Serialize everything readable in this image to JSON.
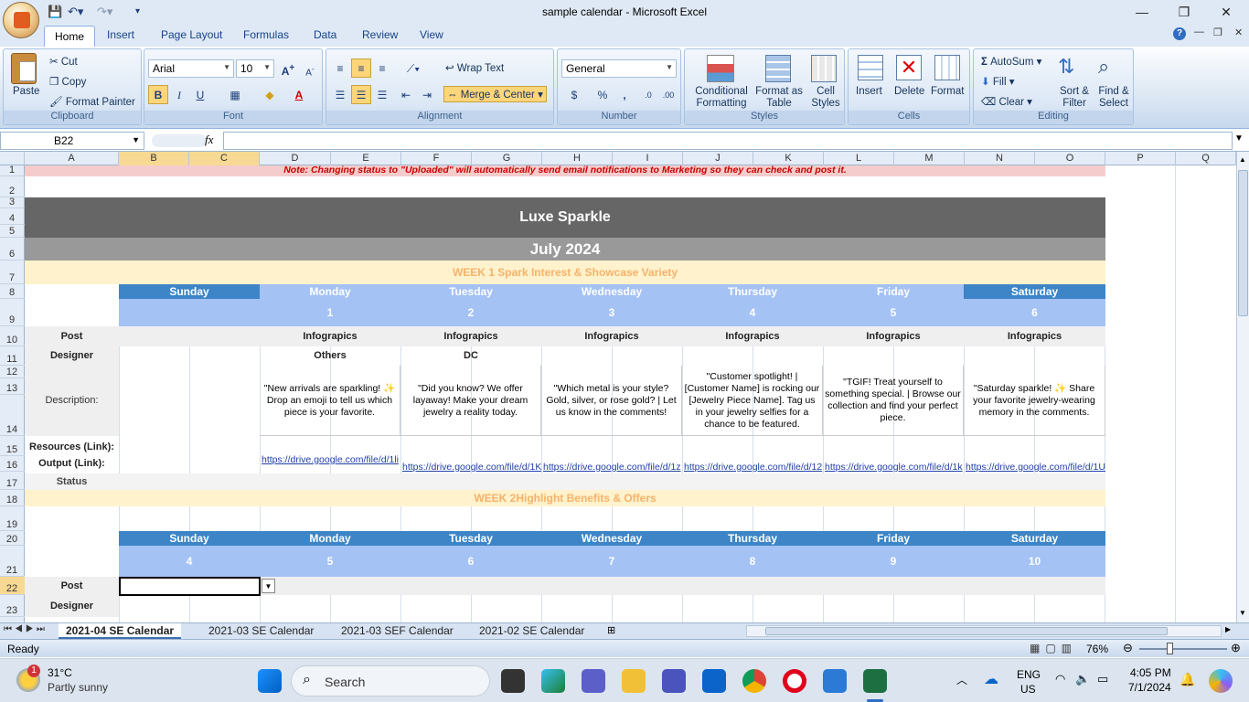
{
  "app": {
    "window_title": "sample calendar - Microsoft Excel",
    "minimize": "—",
    "restore": "❐",
    "close": "✕"
  },
  "ribbon_tabs": [
    "Home",
    "Insert",
    "Page Layout",
    "Formulas",
    "Data",
    "Review",
    "View"
  ],
  "clipboard": {
    "paste": "Paste",
    "cut": "Cut",
    "copy": "Copy",
    "format_painter": "Format Painter",
    "label": "Clipboard"
  },
  "font": {
    "name": "Arial",
    "size": "10",
    "label": "Font",
    "bold": "B",
    "italic": "I",
    "underline": "U"
  },
  "alignment": {
    "wrap_text": "Wrap Text",
    "merge_center": "Merge & Center",
    "label": "Alignment"
  },
  "number": {
    "format": "General",
    "label": "Number",
    "currency": "$",
    "percent": "%",
    "comma": ","
  },
  "styles": {
    "conditional": "Conditional Formatting",
    "format_table": "Format as Table",
    "cell_styles": "Cell Styles",
    "label": "Styles"
  },
  "cells": {
    "insert": "Insert",
    "delete": "Delete",
    "format": "Format",
    "label": "Cells"
  },
  "editing": {
    "autosum": "AutoSum",
    "fill": "Fill",
    "clear": "Clear",
    "sort": "Sort & Filter",
    "find": "Find & Select",
    "label": "Editing"
  },
  "formula_bar": {
    "name_box": "B22",
    "fx": "fx",
    "value": ""
  },
  "columns": [
    "A",
    "B",
    "C",
    "D",
    "E",
    "F",
    "G",
    "H",
    "I",
    "J",
    "K",
    "L",
    "M",
    "N",
    "O",
    "P",
    "Q"
  ],
  "rows": [
    "1",
    "2",
    "3",
    "4",
    "5",
    "6",
    "7",
    "8",
    "9",
    "10",
    "11",
    "12",
    "13",
    "14",
    "15",
    "16",
    "17",
    "18",
    "19",
    "20",
    "21",
    "22",
    "23"
  ],
  "sheet": {
    "note": "Note: Changing status to \"Uploaded\" will automatically send email notifications to Marketing so they can check and post it.",
    "brand": "Luxe Sparkle",
    "month": "July 2024",
    "week1": "WEEK 1 Spark Interest & Showcase Variety",
    "week2": "WEEK 2Highlight Benefits & Offers",
    "days": [
      "Sunday",
      "Monday",
      "Tuesday",
      "Wednesday",
      "Thursday",
      "Friday",
      "Saturday"
    ],
    "week1_dates": [
      "",
      "1",
      "2",
      "3",
      "4",
      "5",
      "6"
    ],
    "week2_dates": [
      "4",
      "5",
      "6",
      "7",
      "8",
      "9",
      "10"
    ],
    "labels": {
      "post": "Post",
      "designer": "Designer",
      "description": "Description:",
      "resources": "Resources (Link):",
      "output": "Output (Link):",
      "status": "Status"
    },
    "posts": [
      "",
      "Infograpics",
      "Infograpics",
      "Infograpics",
      "Infograpics",
      "Infograpics",
      "Infograpics"
    ],
    "designers": [
      "",
      "Others",
      "DC",
      "",
      "",
      "",
      ""
    ],
    "descriptions": [
      "",
      "\"New arrivals are sparkling! ✨ Drop an emoji to tell us which piece is your favorite.",
      "\"Did you know? We offer layaway! Make your dream jewelry a reality today.",
      "\"Which metal is your style? Gold, silver, or rose gold? | Let us know in the comments!",
      "\"Customer spotlight! | [Customer Name] is rocking our [Jewelry Piece Name]. Tag us in your jewelry selfies for a chance to be featured.",
      "\"TGIF! Treat yourself to something special. | Browse our collection and find your perfect piece.",
      "\"Saturday sparkle! ✨ Share your favorite jewelry-wearing memory in the comments."
    ],
    "outputs": [
      "",
      "https://drive.google.com/file/d/1li",
      "https://drive.google.com/file/d/1K",
      "https://drive.google.com/file/d/1z",
      "https://drive.google.com/file/d/12",
      "https://drive.google.com/file/d/1k",
      "https://drive.google.com/file/d/1U"
    ]
  },
  "sheet_tabs": [
    "2021-04 SE Calendar",
    "2021-03 SE Calendar",
    "2021-03 SEF Calendar",
    "2021-02 SE Calendar"
  ],
  "status": {
    "ready": "Ready",
    "zoom": "76%"
  },
  "taskbar": {
    "temp": "31°C",
    "weather": "Partly sunny",
    "search": "Search",
    "lang1": "ENG",
    "lang2": "US",
    "time": "4:05 PM",
    "date": "7/1/2024",
    "badge": "1"
  },
  "colors": {
    "dark_band": "#666666",
    "mid_band": "#999999",
    "week_band": "#fff2cc",
    "day_header": "#3d85c6",
    "date_row": "#a4c2f4",
    "note_bg": "#f4cccc",
    "note_text": "#cc0000",
    "week_text": "#f6b26b"
  }
}
